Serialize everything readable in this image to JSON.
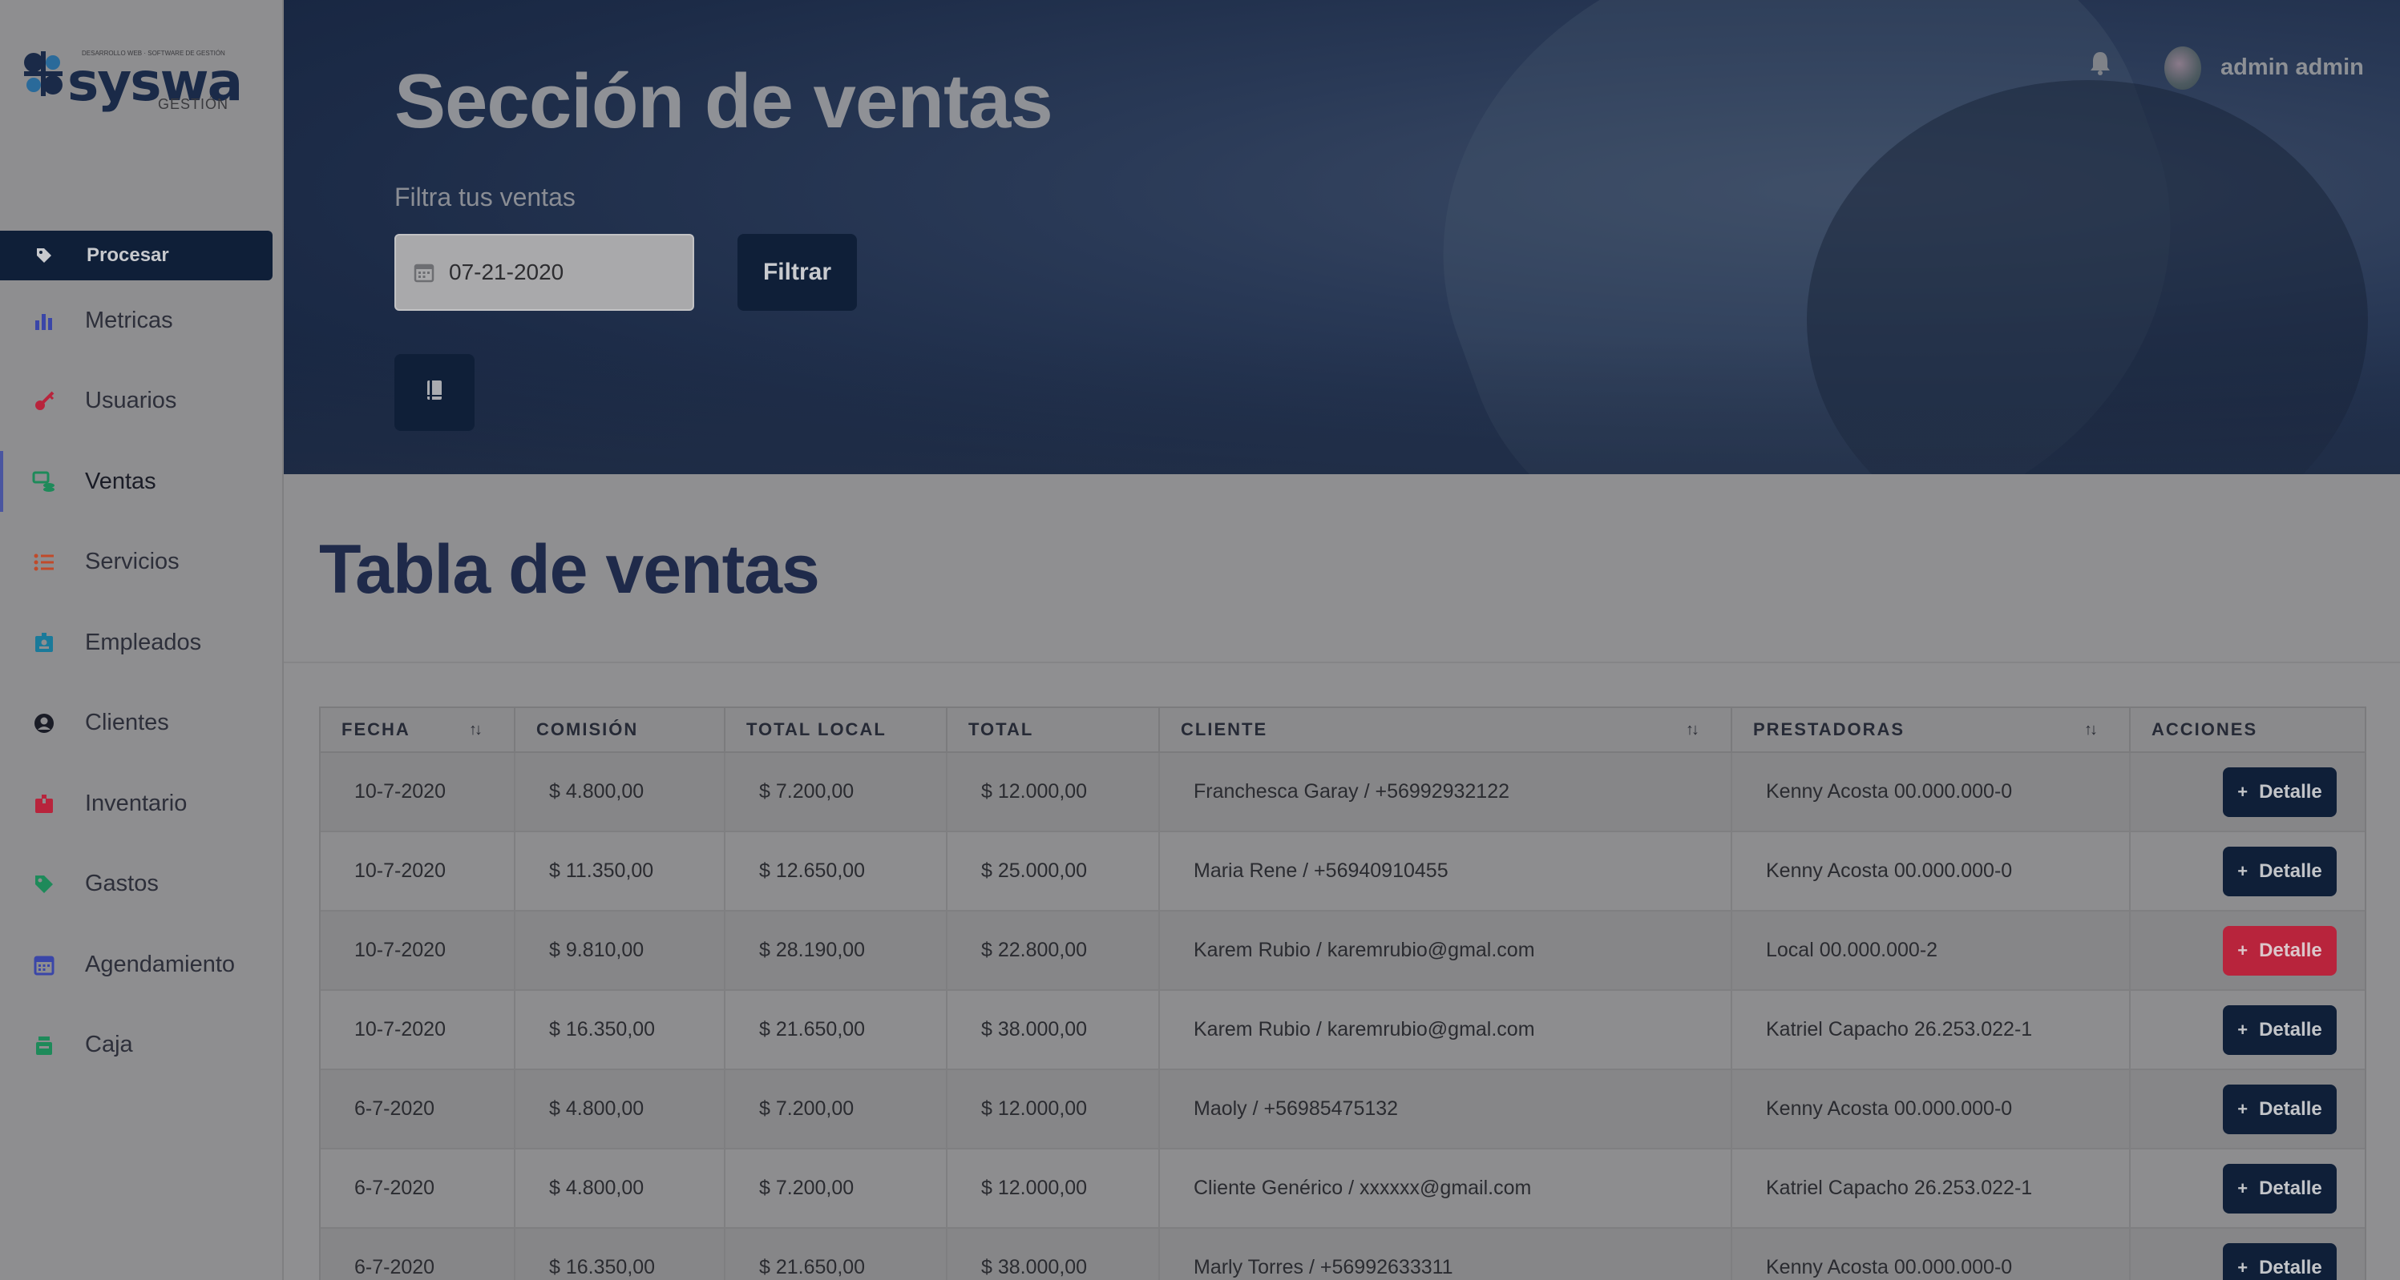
{
  "app": {
    "logo_text": "syswa",
    "logo_sub": "GESTIÓN",
    "logo_tagline": "DESARROLLO WEB · SOFTWARE DE GESTIÓN"
  },
  "sidebar": {
    "procesar_label": "Procesar",
    "items": [
      {
        "label": "Metricas",
        "icon": "bar-chart-icon",
        "color": "#3a46a8"
      },
      {
        "label": "Usuarios",
        "icon": "key-icon",
        "color": "#b8243c"
      },
      {
        "label": "Ventas",
        "icon": "money-icon",
        "color": "#1e8a5a",
        "active": true
      },
      {
        "label": "Servicios",
        "icon": "list-icon",
        "color": "#c04a2a"
      },
      {
        "label": "Empleados",
        "icon": "badge-icon",
        "color": "#1a7a9a"
      },
      {
        "label": "Clientes",
        "icon": "user-circle-icon",
        "color": "#1a1c26"
      },
      {
        "label": "Inventario",
        "icon": "box-icon",
        "color": "#b8243c"
      },
      {
        "label": "Gastos",
        "icon": "tag-icon",
        "color": "#1e8a5a"
      },
      {
        "label": "Agendamiento",
        "icon": "calendar-icon",
        "color": "#3a46a8"
      },
      {
        "label": "Caja",
        "icon": "register-icon",
        "color": "#1e8a5a"
      }
    ]
  },
  "header": {
    "title": "Sección de ventas",
    "filter_label": "Filtra tus ventas",
    "date_value": "07-21-2020",
    "filter_button": "Filtrar",
    "user_name": "admin admin"
  },
  "main": {
    "section_title": "Tabla de ventas",
    "columns": [
      "FECHA",
      "COMISIÓN",
      "TOTAL LOCAL",
      "TOTAL",
      "CLIENTE",
      "PRESTADORAS",
      "ACCIONES"
    ],
    "action_label": "Detalle",
    "rows": [
      {
        "fecha": "10-7-2020",
        "comision": "$ 4.800,00",
        "total_local": "$ 7.200,00",
        "total": "$ 12.000,00",
        "cliente": "Franchesca Garay / +56992932122",
        "prestadora": "Kenny Acosta 00.000.000-0",
        "highlight": false
      },
      {
        "fecha": "10-7-2020",
        "comision": "$ 11.350,00",
        "total_local": "$ 12.650,00",
        "total": "$ 25.000,00",
        "cliente": "Maria Rene / +56940910455",
        "prestadora": "Kenny Acosta 00.000.000-0",
        "highlight": false
      },
      {
        "fecha": "10-7-2020",
        "comision": "$ 9.810,00",
        "total_local": "$ 28.190,00",
        "total": "$ 22.800,00",
        "cliente": "Karem Rubio / karemrubio@gmal.com",
        "prestadora": "Local 00.000.000-2",
        "highlight": true
      },
      {
        "fecha": "10-7-2020",
        "comision": "$ 16.350,00",
        "total_local": "$ 21.650,00",
        "total": "$ 38.000,00",
        "cliente": "Karem Rubio / karemrubio@gmal.com",
        "prestadora": "Katriel Capacho 26.253.022-1",
        "highlight": false
      },
      {
        "fecha": "6-7-2020",
        "comision": "$ 4.800,00",
        "total_local": "$ 7.200,00",
        "total": "$ 12.000,00",
        "cliente": "Maoly / +56985475132",
        "prestadora": "Kenny Acosta 00.000.000-0",
        "highlight": false
      },
      {
        "fecha": "6-7-2020",
        "comision": "$ 4.800,00",
        "total_local": "$ 7.200,00",
        "total": "$ 12.000,00",
        "cliente": "Cliente Genérico / xxxxxx@gmail.com",
        "prestadora": "Katriel Capacho 26.253.022-1",
        "highlight": false
      },
      {
        "fecha": "6-7-2020",
        "comision": "$ 16.350,00",
        "total_local": "$ 21.650,00",
        "total": "$ 38.000,00",
        "cliente": "Marly Torres / +56992633311",
        "prestadora": "Kenny Acosta 00.000.000-0",
        "highlight": false
      }
    ]
  },
  "colors": {
    "primary": "#0f1f38",
    "danger": "#b8243c"
  }
}
